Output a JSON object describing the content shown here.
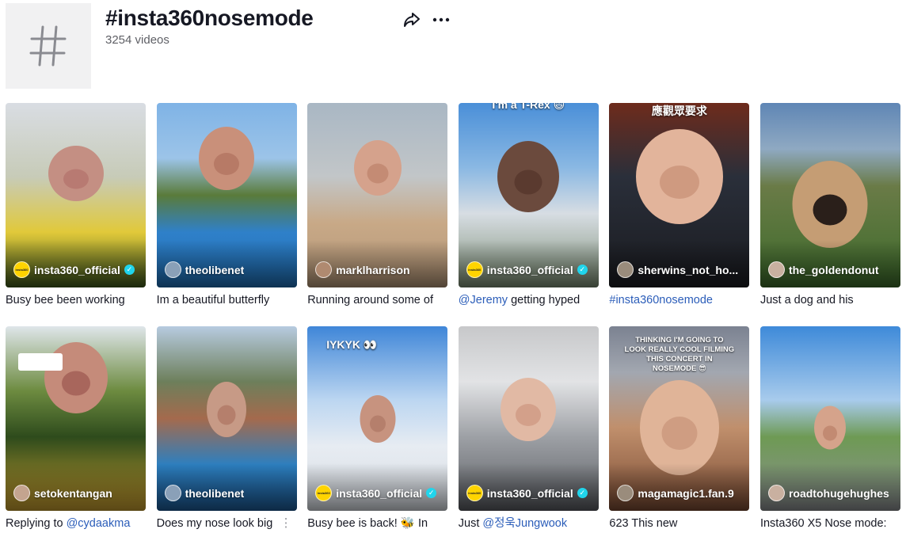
{
  "header": {
    "title": "#insta360nosemode",
    "video_count": "3254 videos",
    "avatar_icon": "hashtag-icon",
    "share_icon": "share-arrow-icon",
    "more_icon": "more-dots-icon"
  },
  "videos": [
    {
      "author": "insta360_official",
      "verified": true,
      "avatar_text": "insta360",
      "caption_pre": "Busy bee been working",
      "caption_mention": "",
      "caption_post": "",
      "overlay": ""
    },
    {
      "author": "theolibenet",
      "verified": false,
      "avatar_text": "",
      "caption_pre": "Im a beautiful butterfly",
      "caption_mention": "",
      "caption_post": "",
      "overlay": ""
    },
    {
      "author": "marklharrison",
      "verified": false,
      "avatar_text": "",
      "caption_pre": "Running around some of",
      "caption_mention": "",
      "caption_post": "",
      "overlay": ""
    },
    {
      "author": "insta360_official",
      "verified": true,
      "avatar_text": "insta360",
      "caption_pre": "",
      "caption_mention": "@Jeremy",
      "caption_post": " getting hyped",
      "overlay": "I'm a T-Rex 😄"
    },
    {
      "author": "sherwins_not_ho...",
      "verified": false,
      "avatar_text": "",
      "caption_pre": "",
      "caption_mention": "#insta360nosemode",
      "caption_post": "",
      "overlay": "應觀眾要求"
    },
    {
      "author": "the_goldendonut",
      "verified": false,
      "avatar_text": "",
      "caption_pre": "Just a dog and his",
      "caption_mention": "",
      "caption_post": "",
      "overlay": ""
    },
    {
      "author": "setokentangan",
      "verified": false,
      "avatar_text": "",
      "caption_pre": "Replying to ",
      "caption_mention": "@cydaakma",
      "caption_post": "",
      "overlay": ""
    },
    {
      "author": "theolibenet",
      "verified": false,
      "avatar_text": "",
      "caption_pre": "Does my nose look big",
      "caption_mention": "",
      "caption_post": "",
      "overlay": "",
      "more": "⋮"
    },
    {
      "author": "insta360_official",
      "verified": true,
      "avatar_text": "insta360",
      "caption_pre": "Busy bee is back! 🐝 In",
      "caption_mention": "",
      "caption_post": "",
      "overlay": "IYKYK 👀"
    },
    {
      "author": "insta360_official",
      "verified": true,
      "avatar_text": "insta360",
      "caption_pre": "Just ",
      "caption_mention": "@정욱Jungwook",
      "caption_post": "",
      "overlay": ""
    },
    {
      "author": "magamagic1.fan.9",
      "verified": false,
      "avatar_text": "",
      "caption_pre": "623 This new",
      "caption_mention": "",
      "caption_post": "",
      "overlay": "THINKING I'M GOING TO LOOK REALLY COOL FILMING THIS CONCERT IN NOSEMODE 😎"
    },
    {
      "author": "roadtohugehughes",
      "verified": false,
      "avatar_text": "",
      "caption_pre": "Insta360 X5 Nose mode:",
      "caption_mention": "",
      "caption_post": "",
      "overlay": ""
    }
  ],
  "colors": {
    "mention": "#2b5db9",
    "verified": "#20d5ec",
    "insta_avatar": "#ffd400"
  }
}
